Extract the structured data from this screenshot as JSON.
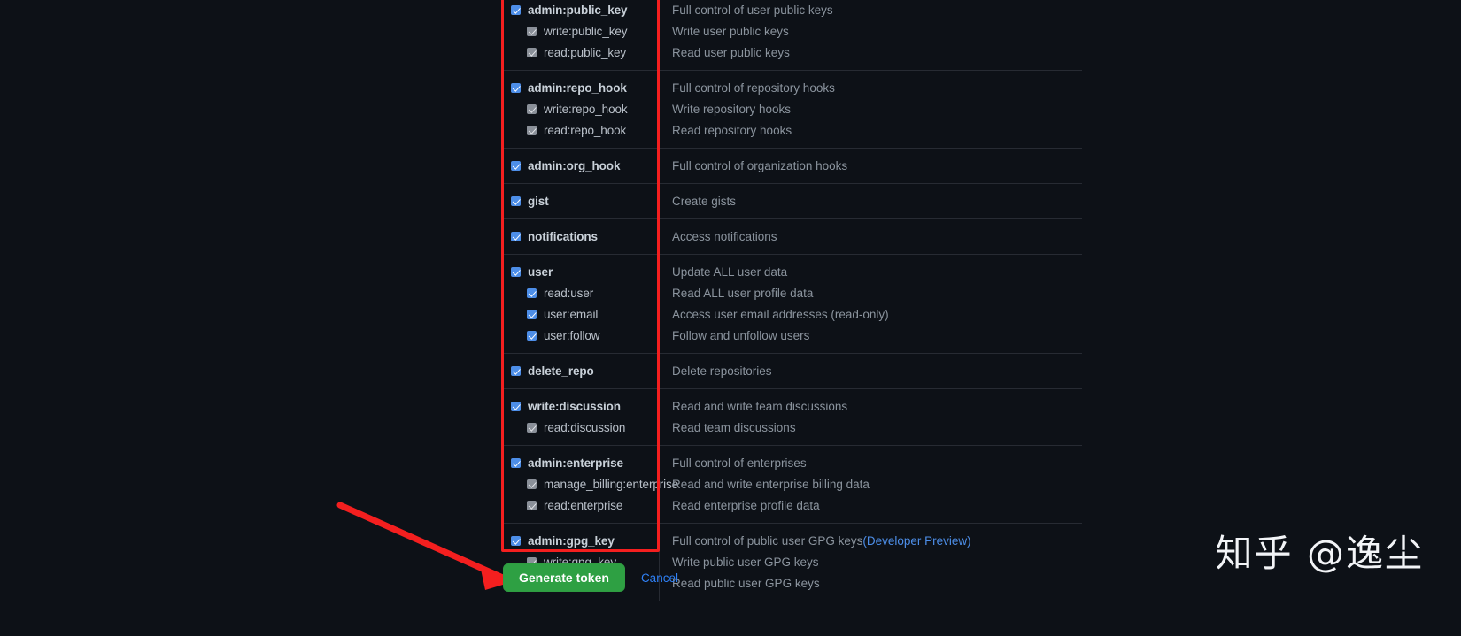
{
  "colors": {
    "background": "#0d1117",
    "accent_blue": "#4d8ee8",
    "link_blue": "#2f81f7",
    "highlight_red": "#f41f1f",
    "button_green": "#2ea043",
    "text_primary": "#c9d1d9",
    "text_secondary": "#8b949e",
    "border": "#272b33"
  },
  "scope_groups": [
    {
      "scopes": [
        {
          "name": "admin:public_key",
          "level": 0,
          "checkbox": "checked",
          "description": "Full control of user public keys"
        },
        {
          "name": "write:public_key",
          "level": 1,
          "checkbox": "disabled",
          "description": "Write user public keys"
        },
        {
          "name": "read:public_key",
          "level": 1,
          "checkbox": "disabled",
          "description": "Read user public keys"
        }
      ]
    },
    {
      "scopes": [
        {
          "name": "admin:repo_hook",
          "level": 0,
          "checkbox": "checked",
          "description": "Full control of repository hooks"
        },
        {
          "name": "write:repo_hook",
          "level": 1,
          "checkbox": "disabled",
          "description": "Write repository hooks"
        },
        {
          "name": "read:repo_hook",
          "level": 1,
          "checkbox": "disabled",
          "description": "Read repository hooks"
        }
      ]
    },
    {
      "scopes": [
        {
          "name": "admin:org_hook",
          "level": 0,
          "checkbox": "checked",
          "description": "Full control of organization hooks"
        }
      ]
    },
    {
      "scopes": [
        {
          "name": "gist",
          "level": 0,
          "checkbox": "checked",
          "description": "Create gists"
        }
      ]
    },
    {
      "scopes": [
        {
          "name": "notifications",
          "level": 0,
          "checkbox": "checked",
          "description": "Access notifications"
        }
      ]
    },
    {
      "scopes": [
        {
          "name": "user",
          "level": 0,
          "checkbox": "checked",
          "description": "Update ALL user data"
        },
        {
          "name": "read:user",
          "level": 1,
          "checkbox": "checked",
          "description": "Read ALL user profile data"
        },
        {
          "name": "user:email",
          "level": 1,
          "checkbox": "checked",
          "description": "Access user email addresses (read-only)"
        },
        {
          "name": "user:follow",
          "level": 1,
          "checkbox": "checked",
          "description": "Follow and unfollow users"
        }
      ]
    },
    {
      "scopes": [
        {
          "name": "delete_repo",
          "level": 0,
          "checkbox": "checked",
          "description": "Delete repositories"
        }
      ]
    },
    {
      "scopes": [
        {
          "name": "write:discussion",
          "level": 0,
          "checkbox": "checked",
          "description": "Read and write team discussions"
        },
        {
          "name": "read:discussion",
          "level": 1,
          "checkbox": "disabled",
          "description": "Read team discussions"
        }
      ]
    },
    {
      "scopes": [
        {
          "name": "admin:enterprise",
          "level": 0,
          "checkbox": "checked",
          "description": "Full control of enterprises"
        },
        {
          "name": "manage_billing:enterprise",
          "level": 1,
          "checkbox": "disabled",
          "description": "Read and write enterprise billing data"
        },
        {
          "name": "read:enterprise",
          "level": 1,
          "checkbox": "disabled",
          "description": "Read enterprise profile data"
        }
      ]
    },
    {
      "scopes": [
        {
          "name": "admin:gpg_key",
          "level": 0,
          "checkbox": "checked",
          "description": "Full control of public user GPG keys ",
          "description_link": "(Developer Preview)"
        },
        {
          "name": "write:gpg_key",
          "level": 1,
          "checkbox": "disabled",
          "description": "Write public user GPG keys"
        },
        {
          "name": "read:gpg_key",
          "level": 1,
          "checkbox": "disabled",
          "description": "Read public user GPG keys"
        }
      ]
    }
  ],
  "actions": {
    "generate_label": "Generate token",
    "cancel_label": "Cancel"
  },
  "watermark": {
    "text": "知乎 @逸尘"
  }
}
